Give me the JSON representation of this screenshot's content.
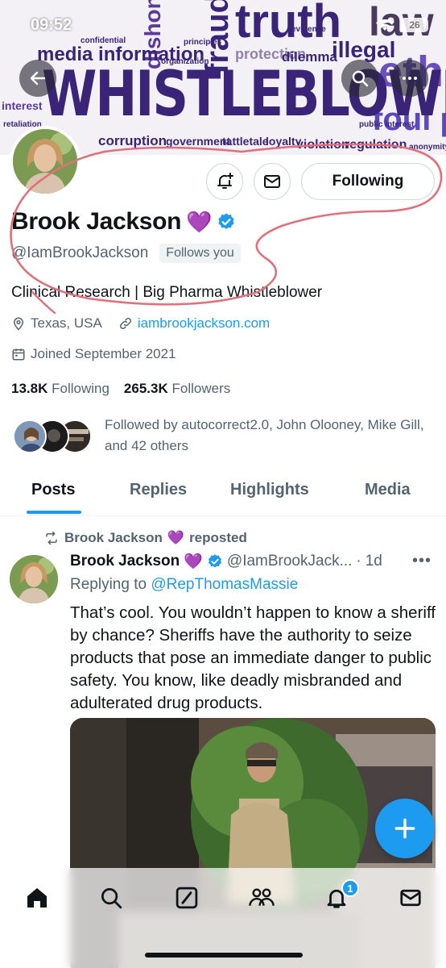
{
  "status_bar": {
    "time": "09:52",
    "battery": "26"
  },
  "banner": {
    "title_word": "WHISTLEBLOWER",
    "words": [
      "truth",
      "law",
      "ethics",
      "foul play",
      "fraud",
      "illegal",
      "dishonest",
      "media information",
      "protection",
      "dilemma",
      "corruption",
      "government",
      "tattletale",
      "loyalty",
      "violation",
      "regulation",
      "interest",
      "principles",
      "organization",
      "evidence",
      "confidential",
      "retaliation",
      "public interest",
      "anonymity"
    ]
  },
  "profile": {
    "name": "Brook Jackson",
    "name_emoji": "💜",
    "handle": "@IamBrookJackson",
    "follows_you": "Follows you",
    "following_button": "Following",
    "bio": "Clinical Research | Big Pharma Whistleblower",
    "location": "Texas, USA",
    "website": "iambrookjackson.com",
    "joined": "Joined September 2021",
    "following_count": "13.8K",
    "following_label": "Following",
    "followers_count": "265.3K",
    "followers_label": "Followers",
    "followed_by": "Followed by autocorrect2.0, John Olooney, Mike Gill, and 42 others"
  },
  "tabs": [
    "Posts",
    "Replies",
    "Highlights",
    "Media"
  ],
  "post": {
    "repost_user": "Brook Jackson",
    "repost_emoji": "💜",
    "repost_label": "reposted",
    "author_name": "Brook Jackson",
    "author_emoji": "💜",
    "author_handle": "@IamBrookJack...",
    "separator": "·",
    "time": "1d",
    "replying_to_label": "Replying to",
    "replying_to_handle": "@RepThomasMassie",
    "text": "That’s cool. You wouldn’t happen to know a sheriff by chance? Sheriffs have the authority to seize products that pose an immediate danger to public safety. You know, like deadly misbranded and adulterated drug products."
  },
  "bottom_nav": {
    "items": [
      "home-icon",
      "search-icon",
      "grok-icon",
      "communities-icon",
      "notifications-icon",
      "messages-icon"
    ],
    "notification_badge": "1"
  },
  "colors": {
    "accent": "#1d9bf0",
    "annotation": "#e0707a",
    "banner_text": "#3a2478"
  }
}
